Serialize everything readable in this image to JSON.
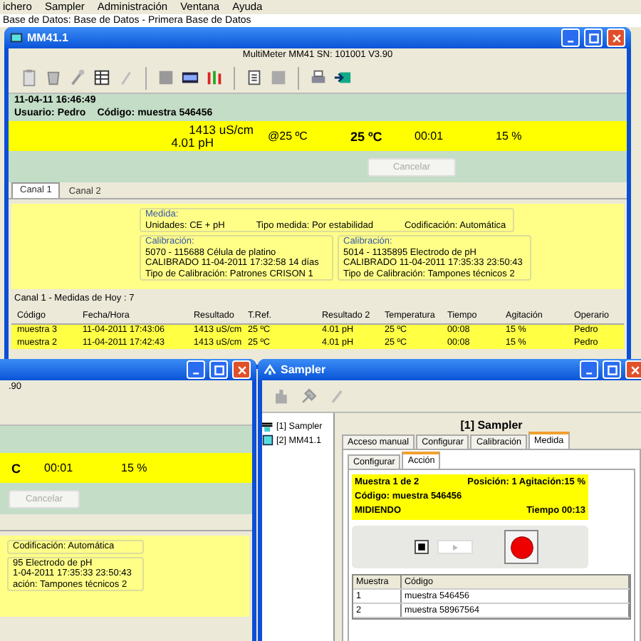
{
  "menu_bar": [
    "ichero",
    "Sampler",
    "Administración",
    "Ventana",
    "Ayuda"
  ],
  "database_line": "Base de Datos: Base de Datos - Primera Base de Datos",
  "main_window": {
    "title": "MM41.1",
    "device_info": "MultiMeter MM41  SN: 101001  V3.90",
    "datetime": "11-04-11  16:46:49",
    "user": "Usuario: Pedro",
    "code": "Código: muestra 546456",
    "reading": {
      "conductivity": "1413 uS/cm",
      "ph": "4.01 pH",
      "ref_temp": "@25 ºC",
      "temperature": "25 ºC",
      "time": "00:01",
      "agitation": "15 %"
    },
    "cancel_button": {
      "label": "Cancelar",
      "disabled": true
    },
    "tabs": [
      {
        "label": "Canal 1",
        "selected": true
      },
      {
        "label": "Canal 2",
        "selected": false
      }
    ],
    "medida": {
      "title": "Medida:",
      "units": "Unidades: CE + pH",
      "type": "Tipo medida: Por estabilidad",
      "coding": "Codificación: Automática"
    },
    "calibrations": [
      {
        "title": "Calibración:",
        "lines": [
          "5070 - 115688 Célula de platino",
          "CALIBRADO 11-04-2011 17:32:58  14 días",
          "Tipo de Calibración: Patrones CRISON 1"
        ]
      },
      {
        "title": "Calibración:",
        "lines": [
          "5014 - 1135895 Electrodo de pH",
          "CALIBRADO 11-04-2011 17:35:33  23:50:43",
          "Tipo de Calibración: Tampones técnicos 2"
        ]
      }
    ],
    "list_title": "Canal 1  - Medidas de Hoy : 7",
    "table": {
      "columns": [
        "Código",
        "Fecha/Hora",
        "Resultado",
        "T.Ref.",
        "Resultado 2",
        "Temperatura",
        "Tiempo",
        "Agitación",
        "Operario"
      ],
      "rows": [
        [
          "muestra 3",
          "11-04-2011 17:43:06",
          "1413 uS/cm",
          "25 ºC",
          "4.01 pH",
          "25 ºC",
          "00:08",
          "15 %",
          "Pedro"
        ],
        [
          "muestra 2",
          "11-04-2011 17:42:43",
          "1413 uS/cm",
          "25 ºC",
          "4.01 pH",
          "25 ºC",
          "00:08",
          "15 %",
          "Pedro"
        ]
      ]
    }
  },
  "back_window": {
    "device_info": ".90",
    "temperature": "C",
    "time": "00:01",
    "agitation": "15 %",
    "cancel_button": {
      "label": "Cancelar",
      "disabled": true
    },
    "coding": "Codificación: Automática",
    "calibration_lines": [
      "95 Electrodo de pH",
      "1-04-2011 17:35:33  23:50:43",
      "ación: Tampones técnicos 2"
    ]
  },
  "sampler_window": {
    "title": "Sampler",
    "tree": [
      "[1] Sampler",
      "[2] MM41.1"
    ],
    "panel_title": "[1] Sampler",
    "tabs": [
      {
        "label": "Acceso manual",
        "selected": false
      },
      {
        "label": "Configurar",
        "selected": false
      },
      {
        "label": "Calibración",
        "selected": false
      },
      {
        "label": "Medida",
        "selected": true
      }
    ],
    "subtabs": [
      {
        "label": "Configurar",
        "selected": false
      },
      {
        "label": "Acción",
        "selected": true
      }
    ],
    "status": {
      "sample": "Muestra 1 de 2",
      "position": "Posición: 1 Agitación:15 %",
      "code": "Código: muestra 546456",
      "state": "MIDIENDO",
      "time": "Tiempo 00:13"
    },
    "controls": [
      {
        "kind": "stop",
        "disabled": false
      },
      {
        "kind": "play",
        "disabled": true
      },
      {
        "kind": "record",
        "disabled": false
      }
    ],
    "table": {
      "columns": [
        "Muestra",
        "Código"
      ],
      "rows": [
        [
          "1",
          "muestra 546456"
        ],
        [
          "2",
          "muestra 58967564"
        ]
      ]
    }
  }
}
